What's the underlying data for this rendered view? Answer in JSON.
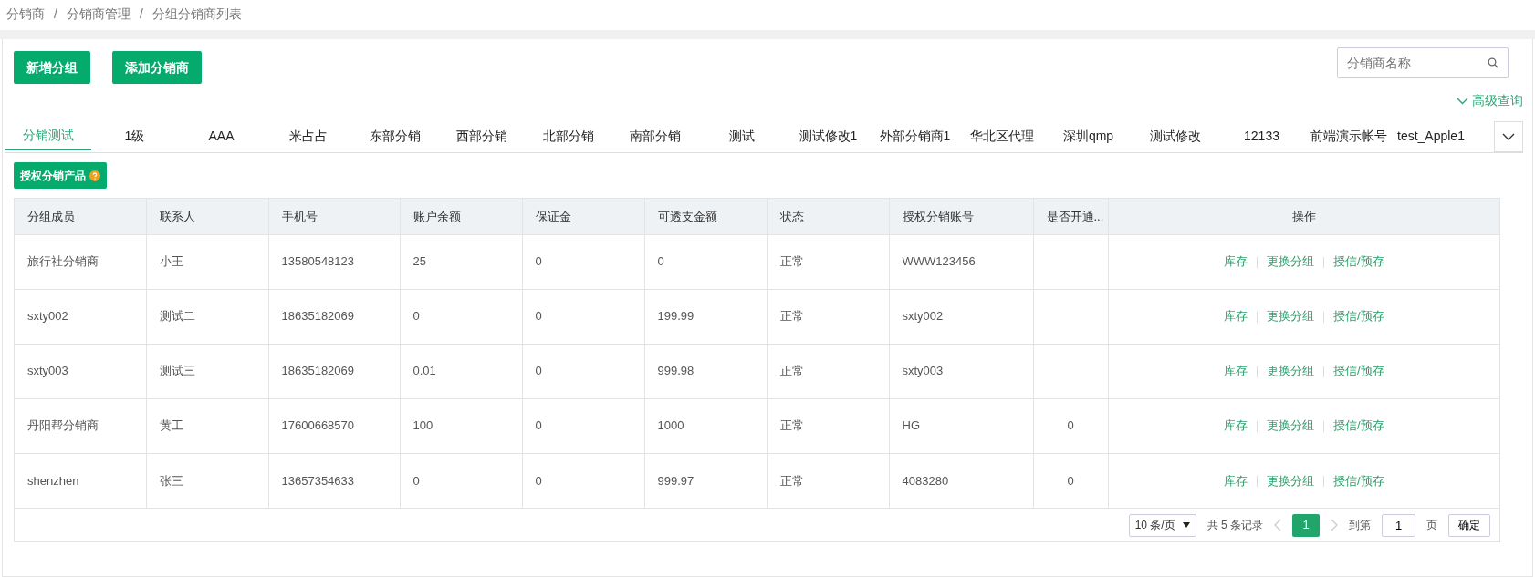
{
  "breadcrumb": [
    "分销商",
    "分销商管理",
    "分组分销商列表"
  ],
  "breadcrumb_separators": [
    "/",
    "/"
  ],
  "toolbar": {
    "buttons": [
      "新增分组",
      "添加分销商"
    ],
    "search": {
      "placeholder": "分销商名称"
    },
    "advanced_query": "高级查询"
  },
  "tabs": [
    {
      "label": "分销测试",
      "selected": true
    },
    {
      "label": "1级",
      "selected": false
    },
    {
      "label": "AAA",
      "selected": false
    },
    {
      "label": "米占占",
      "selected": false
    },
    {
      "label": "东部分销",
      "selected": false
    },
    {
      "label": "西部分销",
      "selected": false
    },
    {
      "label": "北部分销",
      "selected": false
    },
    {
      "label": "南部分销",
      "selected": false
    },
    {
      "label": "测试",
      "selected": false
    },
    {
      "label": "测试修改1",
      "selected": false
    },
    {
      "label": "外部分销商1",
      "selected": false
    },
    {
      "label": "华北区代理",
      "selected": false
    },
    {
      "label": "深圳qmp",
      "selected": false
    },
    {
      "label": "测试修改",
      "selected": false
    },
    {
      "label": "12133",
      "selected": false
    },
    {
      "label": "前端演示帐号",
      "selected": false
    },
    {
      "label": "test_Apple1",
      "selected": false
    }
  ],
  "authorize_button": "授权分销产品",
  "table": {
    "columns": [
      "分组成员",
      "联系人",
      "手机号",
      "账户余额",
      "保证金",
      "可透支金额",
      "状态",
      "授权分销账号",
      "是否开通...",
      "操作"
    ],
    "rows": [
      {
        "member": "旅行社分销商",
        "contact": "小王",
        "phone": "13580548123",
        "balance": "25",
        "deposit": "0",
        "overdraft": "0",
        "status": "正常",
        "account": "WWW123456",
        "actions": [
          "库存",
          "更换分组",
          "授信/预存"
        ]
      },
      {
        "member": "sxty002",
        "contact": "测试二",
        "phone": "18635182069",
        "balance": "0",
        "deposit": "0",
        "overdraft": "199.99",
        "status": "正常",
        "account": "sxty002",
        "actions": [
          "库存",
          "更换分组",
          "授信/预存"
        ]
      },
      {
        "member": "sxty003",
        "contact": "测试三",
        "phone": "18635182069",
        "balance": "0.01",
        "deposit": "0",
        "overdraft": "999.98",
        "status": "正常",
        "account": "sxty003",
        "actions": [
          "库存",
          "更换分组",
          "授信/预存"
        ]
      },
      {
        "member": "丹阳帮分销商",
        "contact": "黄工",
        "phone": "17600668570",
        "balance": "100",
        "deposit": "0",
        "overdraft": "1000",
        "status": "正常",
        "account": "HG",
        "opened": "0",
        "actions": [
          "库存",
          "更换分组",
          "授信/预存"
        ]
      },
      {
        "member": "shenzhen",
        "contact": "张三",
        "phone": "13657354633",
        "balance": "0",
        "deposit": "0",
        "overdraft": "999.97",
        "status": "正常",
        "account": "4083280",
        "opened": "0",
        "actions": [
          "库存",
          "更换分组",
          "授信/预存"
        ]
      }
    ]
  },
  "pagination": {
    "page_size": "10 条/页",
    "total": "共 5 条记录",
    "pages": [
      {
        "label": "1",
        "selected": true
      }
    ],
    "goto_label": "到第",
    "goto_value": "1",
    "page_suffix": "页",
    "confirm": "确定"
  }
}
